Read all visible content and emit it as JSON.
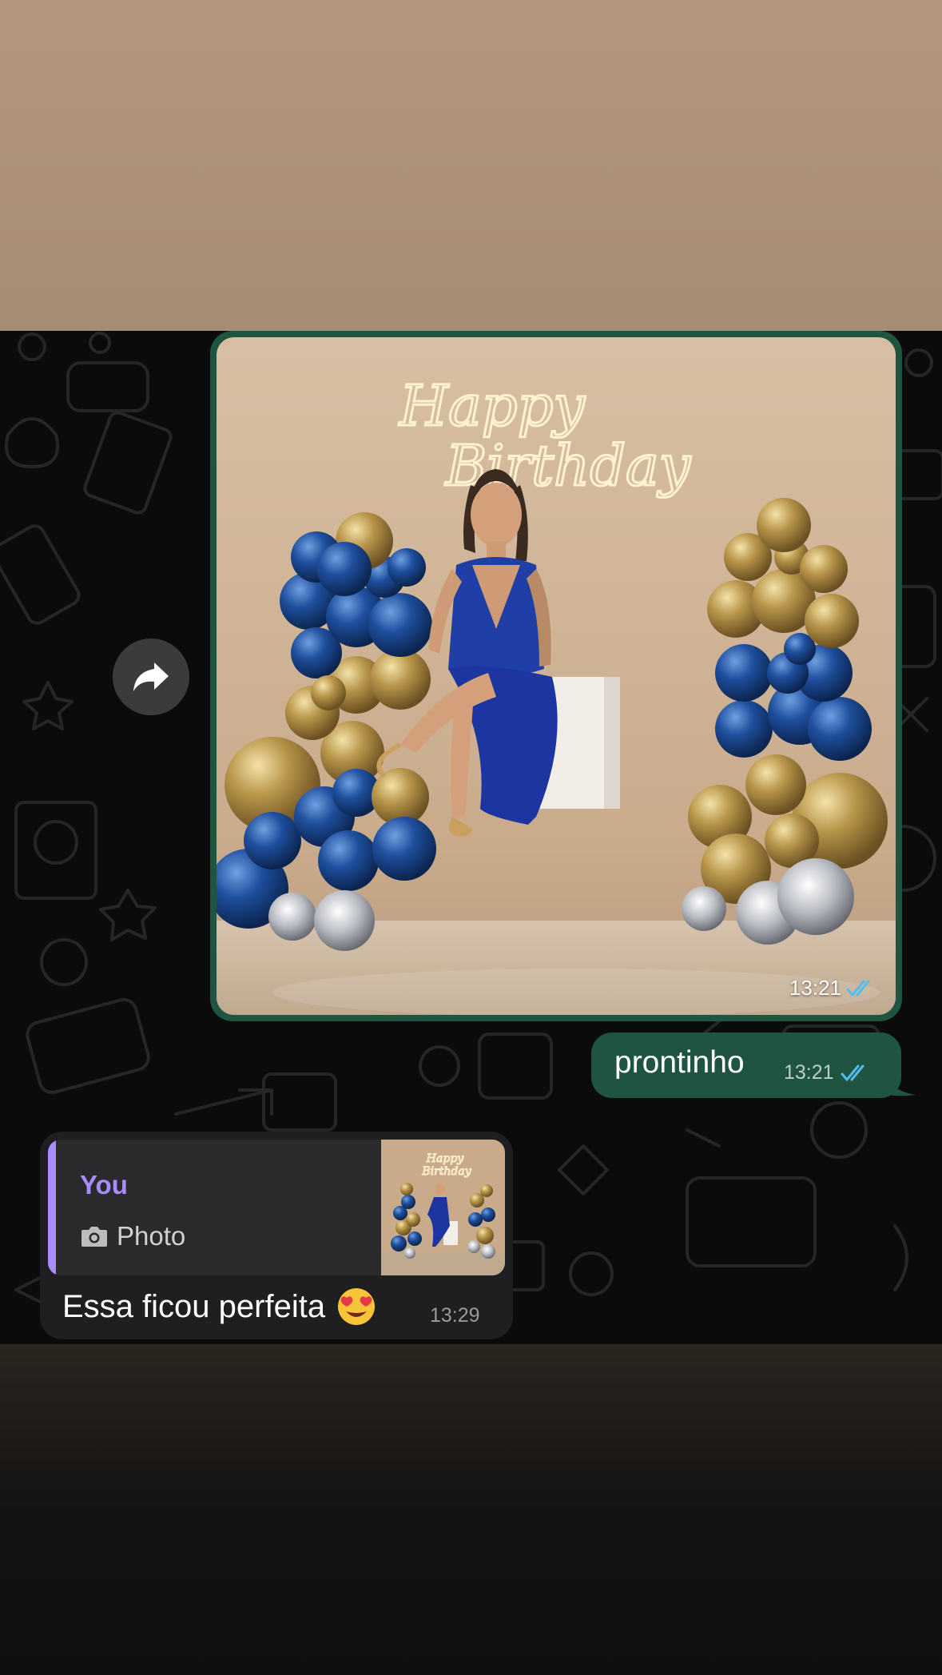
{
  "image_message": {
    "time": "13:21",
    "photo_text": "Happy Birthday",
    "status": "read-double-check-icon"
  },
  "text_message": {
    "text": "prontinho",
    "time": "13:21",
    "status": "read-double-check-icon"
  },
  "reply_message": {
    "quote_author": "You",
    "quote_type": "Photo",
    "text": "Essa ficou perfeita",
    "emoji": "😍",
    "time": "13:29"
  },
  "colors": {
    "outgoing_bubble": "#1f5540",
    "incoming_bubble": "#1f1f21",
    "quote_accent": "#a98cff",
    "read_ticks": "#53bdeb"
  }
}
